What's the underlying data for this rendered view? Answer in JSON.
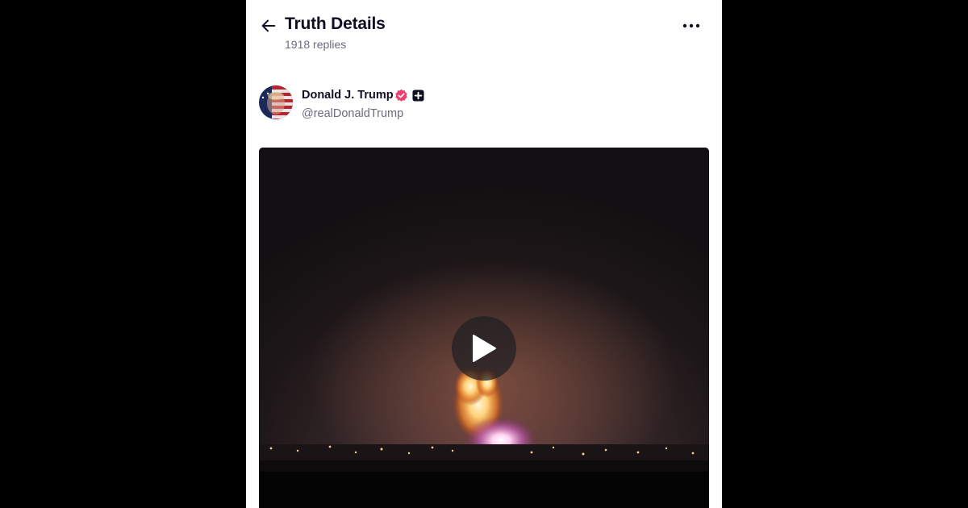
{
  "header": {
    "title": "Truth Details",
    "replies": "1918 replies"
  },
  "post": {
    "author_name": "Donald J. Trump",
    "author_handle": "@realDonaldTrump",
    "verified_badge_color": "#f03c6e",
    "media_type": "video"
  },
  "icons": {
    "back": "arrow-left-icon",
    "more": "more-horizontal-icon",
    "verified": "verified-check-icon",
    "plus": "plus-badge-icon",
    "play": "play-icon"
  },
  "colors": {
    "page_background": "#000000",
    "panel_background": "#ffffff",
    "primary_text": "#0f0f23",
    "secondary_text": "#6b6b80"
  }
}
